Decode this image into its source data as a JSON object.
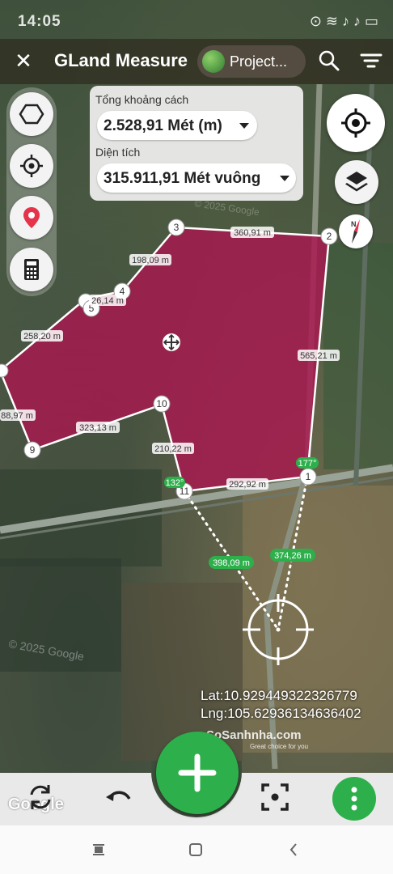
{
  "status_bar": {
    "time": "14:05",
    "icons": "⊙ ≋ ♪ ♪ ▭"
  },
  "app_bar": {
    "title": "GLand Measure",
    "project_label": "Project..."
  },
  "measure_card": {
    "distance_label": "Tổng khoảng cách",
    "distance_value": "2.528,91 Mét (m)",
    "area_label": "Diện tích",
    "area_value": "315.911,91 Mét vuông"
  },
  "map": {
    "vertices": [
      {
        "label": "1"
      },
      {
        "label": "2"
      },
      {
        "label": "3"
      },
      {
        "label": "4"
      },
      {
        "label": "5"
      },
      {
        "label": "9"
      },
      {
        "label": "10"
      },
      {
        "label": "11"
      }
    ],
    "edge_lengths": {
      "e2_3": "360,91 m",
      "e3_4": "198,09 m",
      "e4_5": "26,14 m",
      "e5_left": "258,20 m",
      "left_9": "88,97 m",
      "e9_10": "323,13 m",
      "e10_11": "210,22 m",
      "e11_1": "292,92 m",
      "e1_2": "565,21 m"
    },
    "angles": {
      "a1": "177°",
      "a11": "132°"
    },
    "cursor_distances": {
      "to11": "398,09 m",
      "to1": "374,26 m"
    },
    "watermark_text": "© 2025 Google"
  },
  "coordinates": {
    "lat": "Lat:10.929449322326779",
    "lng": "Lng:105.62936134636402"
  },
  "watermark": {
    "brand": "SoSanhnha.com",
    "tagline": "Great choice for you"
  },
  "google_logo": "Google",
  "colors": {
    "polygon_fill": "#a8174f",
    "accent_green": "#2db04b"
  }
}
